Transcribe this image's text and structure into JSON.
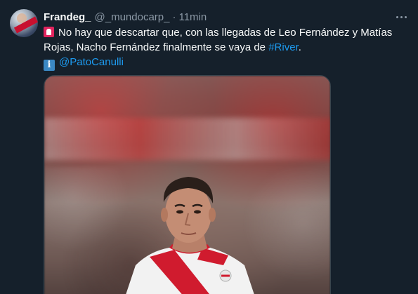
{
  "user": {
    "display_name": "Frandeg_",
    "handle": "@_mundocarp_",
    "separator": "·",
    "time": "11min"
  },
  "tweet": {
    "line1": "No hay que descartar que, con las llegadas de Leo Fernández y Matías",
    "line2_prefix": "Rojas, Nacho Fernández finalmente se vaya de ",
    "hashtag": "#River",
    "line2_suffix": ".",
    "mention": "@PatoCanulli",
    "info_emoji": "i"
  },
  "icons": {
    "avatar": "avatar",
    "more": "more-options-icon",
    "siren": "red-siren-emoji",
    "info": "info-emoji"
  },
  "colors": {
    "background": "#15202b",
    "text": "#f7f9f9",
    "secondary": "#8b98a5",
    "link": "#1d9bf0",
    "jersey_red": "#d01b2e"
  }
}
